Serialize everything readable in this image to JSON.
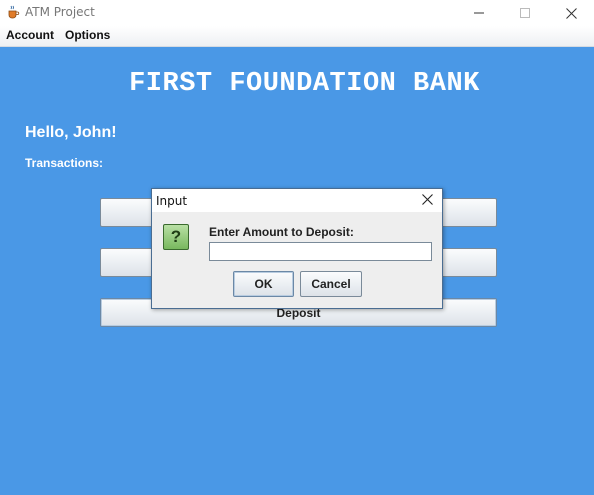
{
  "window": {
    "title": "ATM Project",
    "icons": {
      "app": "java-cup-icon",
      "minimize": "minimize-icon",
      "maximize": "maximize-icon",
      "close": "close-icon"
    }
  },
  "menubar": {
    "items": [
      {
        "label": "Account"
      },
      {
        "label": "Options"
      }
    ]
  },
  "main": {
    "bank_name": "FIRST FOUNDATION BANK",
    "greeting": "Hello, John!",
    "transactions_label": "Transactions:",
    "buttons": [
      {
        "label": ""
      },
      {
        "label": ""
      },
      {
        "label": "Deposit"
      }
    ]
  },
  "dialog": {
    "title": "Input",
    "icon": "question-icon",
    "icon_glyph": "?",
    "prompt": "Enter Amount to Deposit:",
    "input_value": "",
    "ok_label": "OK",
    "cancel_label": "Cancel"
  },
  "colors": {
    "background": "#4a98e6",
    "text_light": "#ffffff",
    "icon_green": "#78b85e"
  }
}
